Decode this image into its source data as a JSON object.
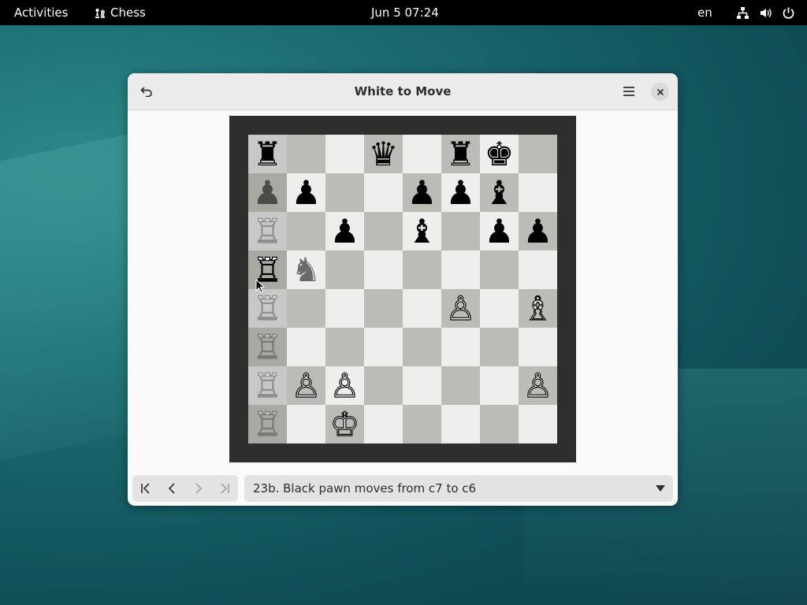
{
  "topbar": {
    "activities": "Activities",
    "app_name": "Chess",
    "clock": "Jun 5  07:24",
    "lang": "en"
  },
  "window": {
    "title": "White to Move",
    "history_text": "23b. Black pawn moves from c7 to c6"
  },
  "board": {
    "ranks": [
      [
        "♜",
        "",
        "",
        "♛",
        "",
        "♜",
        "♚",
        ""
      ],
      [
        "♟",
        "♟",
        "",
        "",
        "♟",
        "♟",
        "♝",
        ""
      ],
      [
        "♖",
        "",
        "♟",
        "",
        "♝",
        "",
        "♟",
        "♟"
      ],
      [
        "♖",
        "♞",
        "",
        "",
        "",
        "",
        "",
        ""
      ],
      [
        "♖",
        "",
        "",
        "",
        "",
        "♙",
        "",
        "♗"
      ],
      [
        "♖",
        "",
        "",
        "",
        "",
        "",
        "",
        ""
      ],
      [
        "♖",
        "♙",
        "♙",
        "",
        "",
        "",
        "",
        "♙"
      ],
      [
        "♖",
        "",
        "♔",
        "",
        "",
        "",
        "",
        ""
      ]
    ],
    "colors": [
      [
        "b",
        "",
        "",
        "b",
        "",
        "b",
        "b",
        ""
      ],
      [
        "b",
        "b",
        "",
        "",
        "b",
        "b",
        "b",
        ""
      ],
      [
        "w",
        "",
        "b",
        "",
        "b",
        "",
        "b",
        "b"
      ],
      [
        "w",
        "b",
        "",
        "",
        "",
        "",
        "",
        ""
      ],
      [
        "w",
        "",
        "",
        "",
        "",
        "w",
        "",
        "w"
      ],
      [
        "w",
        "",
        "",
        "",
        "",
        "",
        "",
        ""
      ],
      [
        "w",
        "w",
        "w",
        "",
        "",
        "",
        "",
        "w"
      ],
      [
        "w",
        "",
        "w",
        "",
        "",
        "",
        "",
        ""
      ]
    ],
    "opacity": [
      [
        "",
        "",
        "",
        "",
        "",
        "",
        "",
        ""
      ],
      [
        "mid",
        "",
        "",
        "",
        "",
        "",
        "",
        ""
      ],
      [
        "faint",
        "",
        "",
        "",
        "",
        "",
        "",
        ""
      ],
      [
        "",
        "mid",
        "",
        "",
        "",
        "",
        "",
        ""
      ],
      [
        "faint",
        "",
        "",
        "",
        "",
        "",
        "",
        ""
      ],
      [
        "faint",
        "",
        "",
        "",
        "",
        "",
        "",
        ""
      ],
      [
        "faint",
        "",
        "",
        "",
        "",
        "",
        "",
        ""
      ],
      [
        "faint",
        "",
        "",
        "",
        "",
        "",
        "",
        ""
      ]
    ]
  },
  "colors": {
    "topbar_bg": "#000000",
    "board_frame": "#2e2e2e",
    "light_square": "#eeeeec",
    "dark_square": "#babdb6"
  }
}
